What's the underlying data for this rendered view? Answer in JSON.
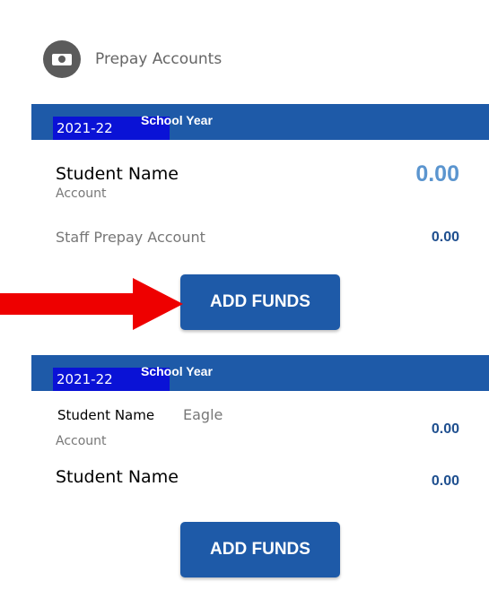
{
  "header": {
    "title": "Prepay Accounts",
    "icon": "money-bill-icon"
  },
  "accent_color": "#1e5aa8",
  "groups": [
    {
      "year": "2021-22",
      "year_label": "School Year",
      "rows": [
        {
          "name": "Student Name",
          "sub": "Account",
          "amount": "0.00"
        },
        {
          "name": "Staff Prepay Account",
          "amount": "0.00"
        }
      ],
      "button": "ADD FUNDS"
    },
    {
      "year": "2021-22",
      "year_label": "School Year",
      "rows": [
        {
          "name": "Student Name",
          "name_extra": "Eagle",
          "sub": "Account",
          "amount": "0.00"
        },
        {
          "name": "Student Name",
          "amount": "0.00"
        }
      ],
      "button": "ADD FUNDS"
    }
  ]
}
